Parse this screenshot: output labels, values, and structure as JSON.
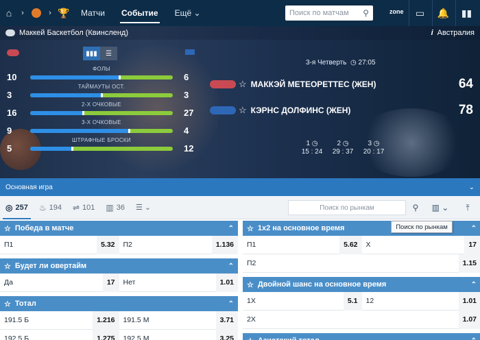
{
  "nav": {
    "links": [
      "Матчи",
      "Событие",
      "Ещё"
    ],
    "search_placeholder": "Поиск по матчам",
    "zone": "zone"
  },
  "event": {
    "league": "Маккей Баскетбол (Квинсленд)",
    "region": "Австралия",
    "period": "3-я Четверть",
    "clock": "27:05",
    "teams": [
      {
        "name": "МАККЭЙ МЕТЕОРЕТТЕС (ЖЕН)",
        "score": "64",
        "color": "#c94a53"
      },
      {
        "name": "КЭРНС ДОЛФИНС (ЖЕН)",
        "score": "78",
        "color": "#2e67b6"
      }
    ],
    "quarters": [
      {
        "num": "1",
        "score": "15 : 24"
      },
      {
        "num": "2",
        "score": "29 : 37"
      },
      {
        "num": "3",
        "score": "20 : 17"
      }
    ]
  },
  "stats": [
    {
      "label": "ФОЛЫ",
      "left": "10",
      "right": "6",
      "share": 0.625
    },
    {
      "label": "ТАЙМАУТЫ ОСТ.",
      "left": "3",
      "right": "3",
      "share": 0.5
    },
    {
      "label": "2-Х ОЧКОВЫЕ",
      "left": "16",
      "right": "27",
      "share": 0.372
    },
    {
      "label": "3-Х ОЧКОВЫЕ",
      "left": "9",
      "right": "4",
      "share": 0.692
    },
    {
      "label": "ШТРАФНЫЕ БРОСКИ",
      "left": "5",
      "right": "12",
      "share": 0.294
    }
  ],
  "main_game": "Основная игра",
  "filters": [
    {
      "icon": "◎",
      "count": "257",
      "active": true
    },
    {
      "icon": "♨",
      "count": "194",
      "active": false
    },
    {
      "icon": "⇌",
      "count": "101",
      "active": false
    },
    {
      "icon": "▥",
      "count": "36",
      "active": false
    }
  ],
  "market_search_placeholder": "Поиск по рынкам",
  "tooltip": "Поиск по рынкам",
  "markets_left": [
    {
      "title": "Победа в матче",
      "rows": [
        [
          {
            "l": "П1",
            "o": "5.32"
          },
          {
            "l": "П2",
            "o": "1.136"
          }
        ]
      ]
    },
    {
      "title": "Будет ли овертайм",
      "rows": [
        [
          {
            "l": "Да",
            "o": "17"
          },
          {
            "l": "Нет",
            "o": "1.01"
          }
        ]
      ]
    },
    {
      "title": "Тотал",
      "rows": [
        [
          {
            "l": "191.5 Б",
            "o": "1.216"
          },
          {
            "l": "191.5 М",
            "o": "3.71"
          }
        ],
        [
          {
            "l": "192.5 Б",
            "o": "1.275"
          },
          {
            "l": "192.5 М",
            "o": "3.25"
          }
        ]
      ]
    }
  ],
  "markets_right": [
    {
      "title": "1х2 на основное время",
      "rows": [
        [
          {
            "l": "П1",
            "o": "5.62"
          },
          {
            "l": "Х",
            "o": "17"
          }
        ],
        [
          {
            "l": "П2",
            "o": "1.15"
          }
        ]
      ]
    },
    {
      "title": "Двойной шанс на основное время",
      "rows": [
        [
          {
            "l": "1Х",
            "o": "5.1"
          },
          {
            "l": "12",
            "o": "1.01"
          }
        ],
        [
          {
            "l": "2Х",
            "o": "1.07"
          }
        ]
      ]
    },
    {
      "title": "Азиатский тотал",
      "rows": []
    }
  ]
}
